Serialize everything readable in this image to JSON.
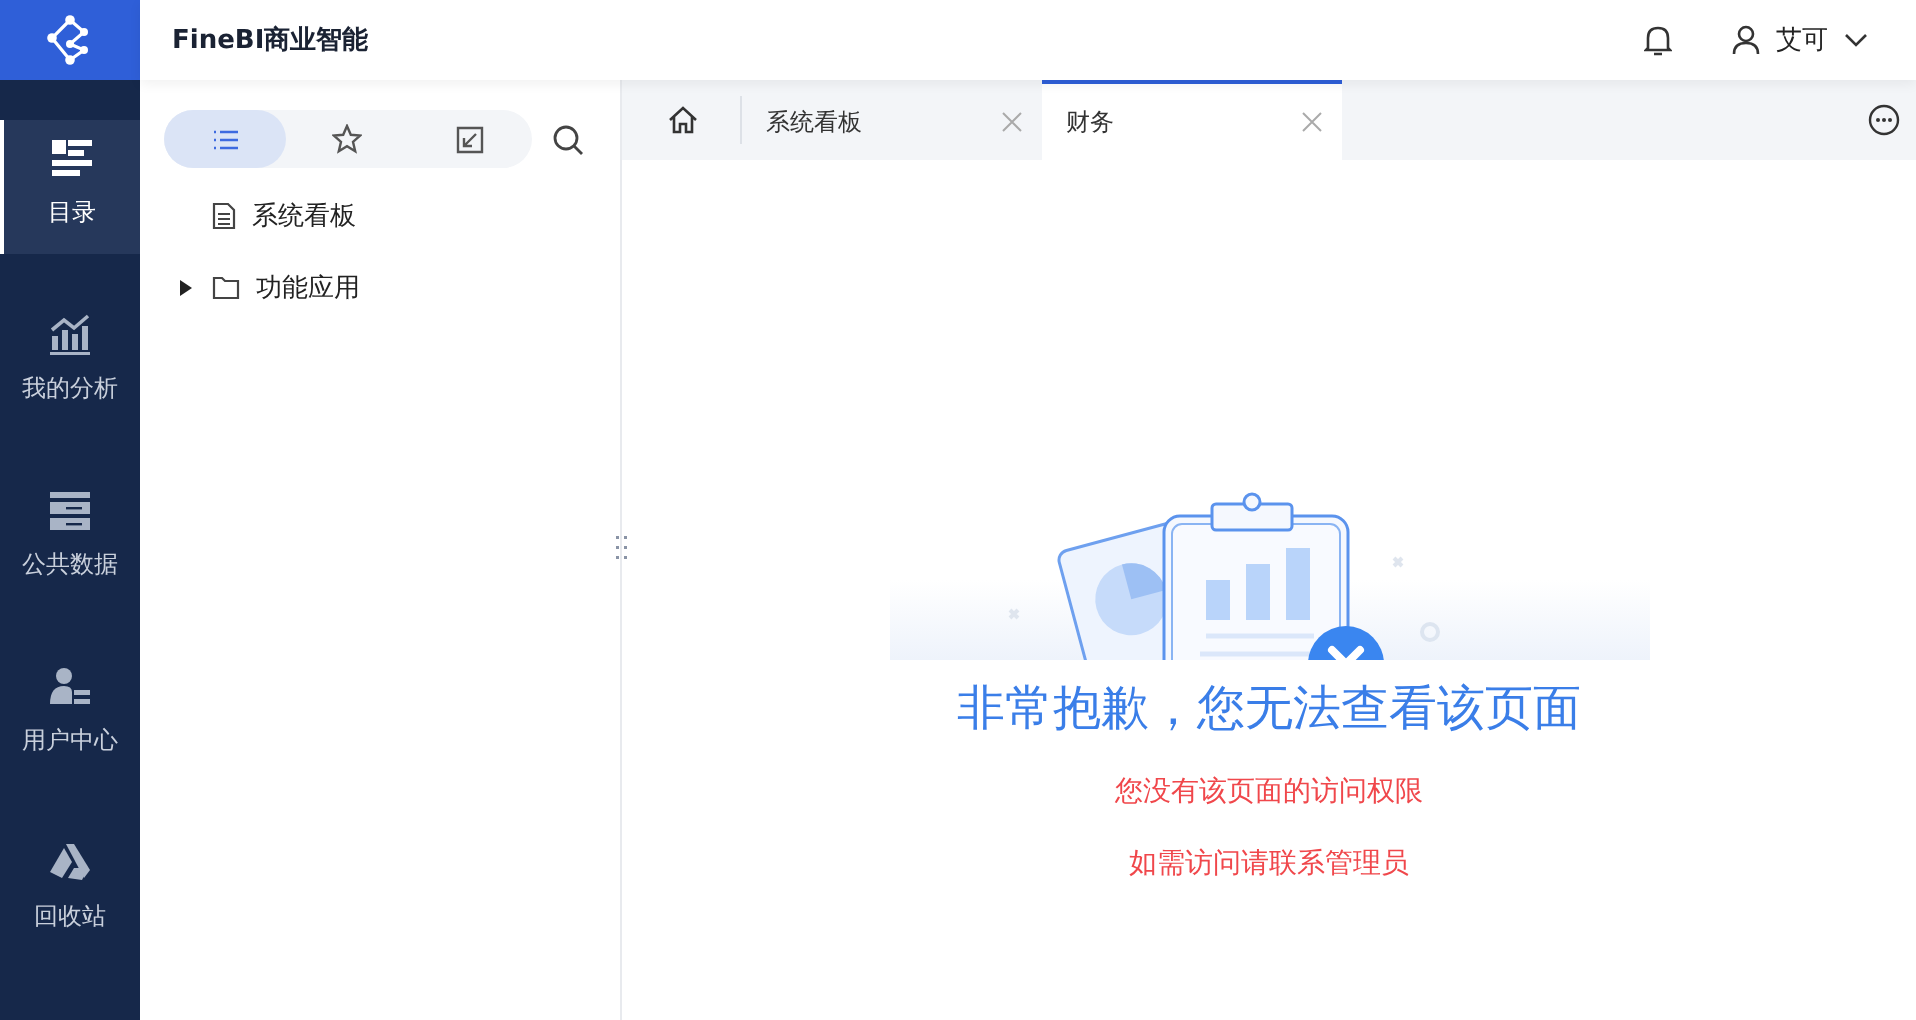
{
  "app_title": "FineBI商业智能",
  "user": {
    "name": "艾可"
  },
  "nav": [
    {
      "kind": "catalog",
      "label": "目录",
      "selected": true
    },
    {
      "kind": "analysis",
      "label": "我的分析",
      "selected": false
    },
    {
      "kind": "data",
      "label": "公共数据",
      "selected": false
    },
    {
      "kind": "users",
      "label": "用户中心",
      "selected": false
    },
    {
      "kind": "recycle",
      "label": "回收站",
      "selected": false
    }
  ],
  "panel_tabs": [
    {
      "kind": "list",
      "selected": true
    },
    {
      "kind": "favorite",
      "selected": false
    },
    {
      "kind": "import",
      "selected": false
    }
  ],
  "tree": [
    {
      "kind": "file",
      "label": "系统看板"
    },
    {
      "kind": "folder",
      "label": "功能应用",
      "expanded": false
    }
  ],
  "tabs": [
    {
      "label": "系统看板",
      "selected": false
    },
    {
      "label": "财务",
      "selected": true
    }
  ],
  "message": {
    "title": "非常抱歉，您无法查看该页面",
    "lines": [
      "您没有该页面的访问权限",
      "如需访问请联系管理员"
    ]
  }
}
